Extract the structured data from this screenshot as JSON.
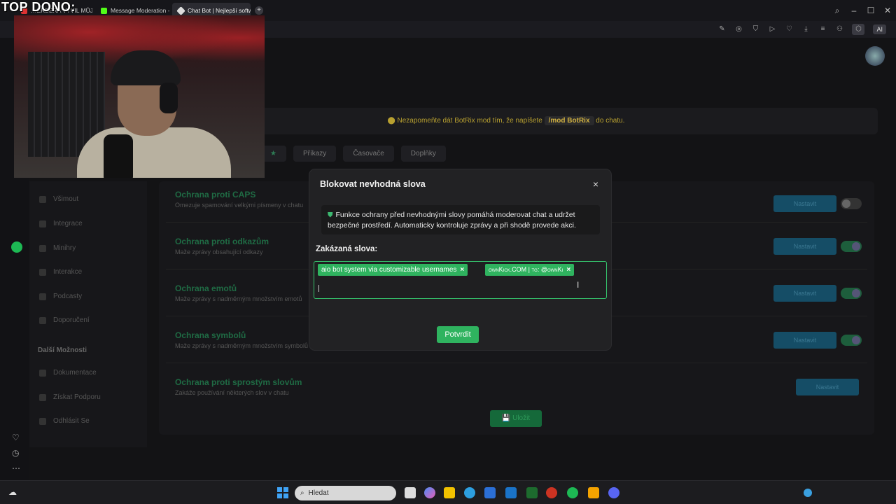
{
  "overlay": {
    "top_text": "TOP DONO:"
  },
  "browser": {
    "tabs": [
      {
        "label": "…ERBERA VYVIL MŮJ GY",
        "active": false,
        "favicon": "#d33"
      },
      {
        "label": "Message Moderation - Ki",
        "active": false,
        "favicon": "#53fc18"
      },
      {
        "label": "Chat Bot | Nejlepší softwa",
        "active": true,
        "favicon": "#ddd"
      }
    ],
    "new_tab_label": "+",
    "ai_label": "AI"
  },
  "page": {
    "notice": {
      "prefix": "⬤ Nezapomeňte dát BotRix mod tím, že napíšete",
      "command": "/mod BotRix",
      "suffix": "do chatu."
    },
    "top_tabs": [
      "★",
      "Příkazy",
      "Časovače",
      "Doplňky"
    ],
    "sidebar": {
      "items": [
        "Všimout",
        "Integrace",
        "Minihry",
        "Interakce",
        "Podcasty",
        "Doporučení"
      ],
      "section_title": "Další Možnosti",
      "extra": [
        "Dokumentace",
        "Získat Podporu",
        "Odhlásit Se"
      ]
    },
    "rows": [
      {
        "title": "Ochrana proti CAPS",
        "desc": "Omezuje spamování velkými písmeny v chatu",
        "button": "Nastavit",
        "toggle": false
      },
      {
        "title": "Ochrana proti odkazům",
        "desc": "Maže zprávy obsahující odkazy",
        "button": "Nastavit",
        "toggle": true
      },
      {
        "title": "Ochrana emotů",
        "desc": "Maže zprávy s nadměrným množstvím emotů",
        "button": "Nastavit",
        "toggle": true
      },
      {
        "title": "Ochrana symbolů",
        "desc": "Maže zprávy s nadměrným množstvím symbolů",
        "button": "Nastavit",
        "toggle": true
      },
      {
        "title": "Ochrana proti sprostým slovům",
        "desc": "Zakáže používání některých slov v chatu",
        "button": "Nastavit",
        "toggle": null
      }
    ],
    "save_label": "💾 Uložit"
  },
  "modal": {
    "title": "Blokovat nevhodná slova",
    "close": "×",
    "info": "Funkce ochrany před nevhodnými slovy pomáhá moderovat chat a udržet bezpečné prostředí. Automaticky kontroluje zprávy a při shodě provede akci.",
    "label": "Zakázaná slova:",
    "chips": [
      "aio bot system via customizable usernames",
      "ownKick.COM | tg: @ownKi"
    ],
    "chip_remove": "×",
    "confirm": "Potvrdit",
    "colors": {
      "accent": "#2fb35f",
      "background": "#222224"
    }
  },
  "taskbar": {
    "search_placeholder": "Hledat"
  }
}
